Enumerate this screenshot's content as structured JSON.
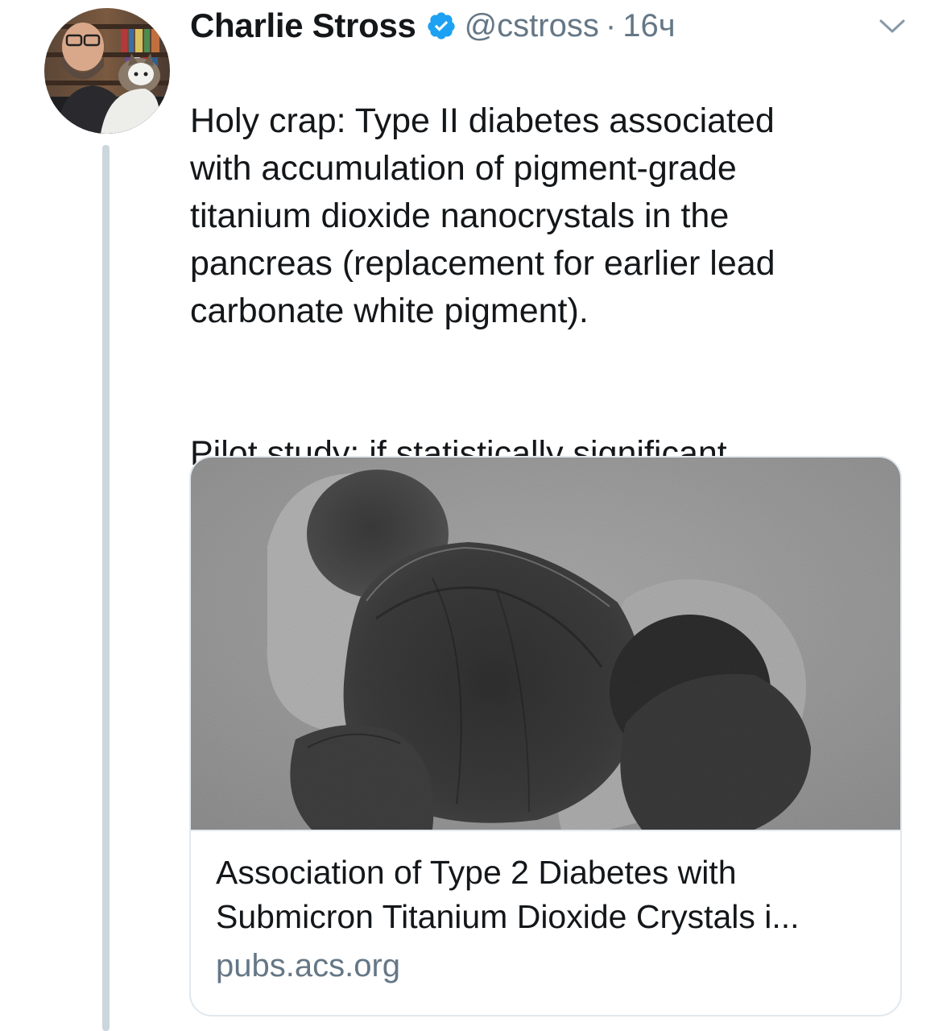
{
  "tweet": {
    "author_name": "Charlie Stross",
    "handle": "@cstross",
    "separator": "·",
    "time": "16ч",
    "text_paragraph_1": "Holy crap: Type II diabetes associated\nwith accumulation of pigment-grade\ntitanium dioxide nanocrystals in the\npancreas (replacement for earlier lead\ncarbonate white pigment).",
    "text_paragraph_2": "Pilot study: if statistically significant\nstudies support this, it's dynamite."
  },
  "card": {
    "title": "Association of Type 2 Diabetes with\nSubmicron Titanium Dioxide Crystals i...",
    "domain": "pubs.acs.org",
    "image_icon": "electron-micrograph-image"
  },
  "icons": {
    "verified": "verified-badge-icon",
    "caret": "chevron-down-icon"
  },
  "colors": {
    "verified_blue": "#1da1f2",
    "secondary_text": "#657786",
    "primary_text": "#14171a",
    "thread_line": "#ccd6dd",
    "border": "#e1e8ed"
  }
}
